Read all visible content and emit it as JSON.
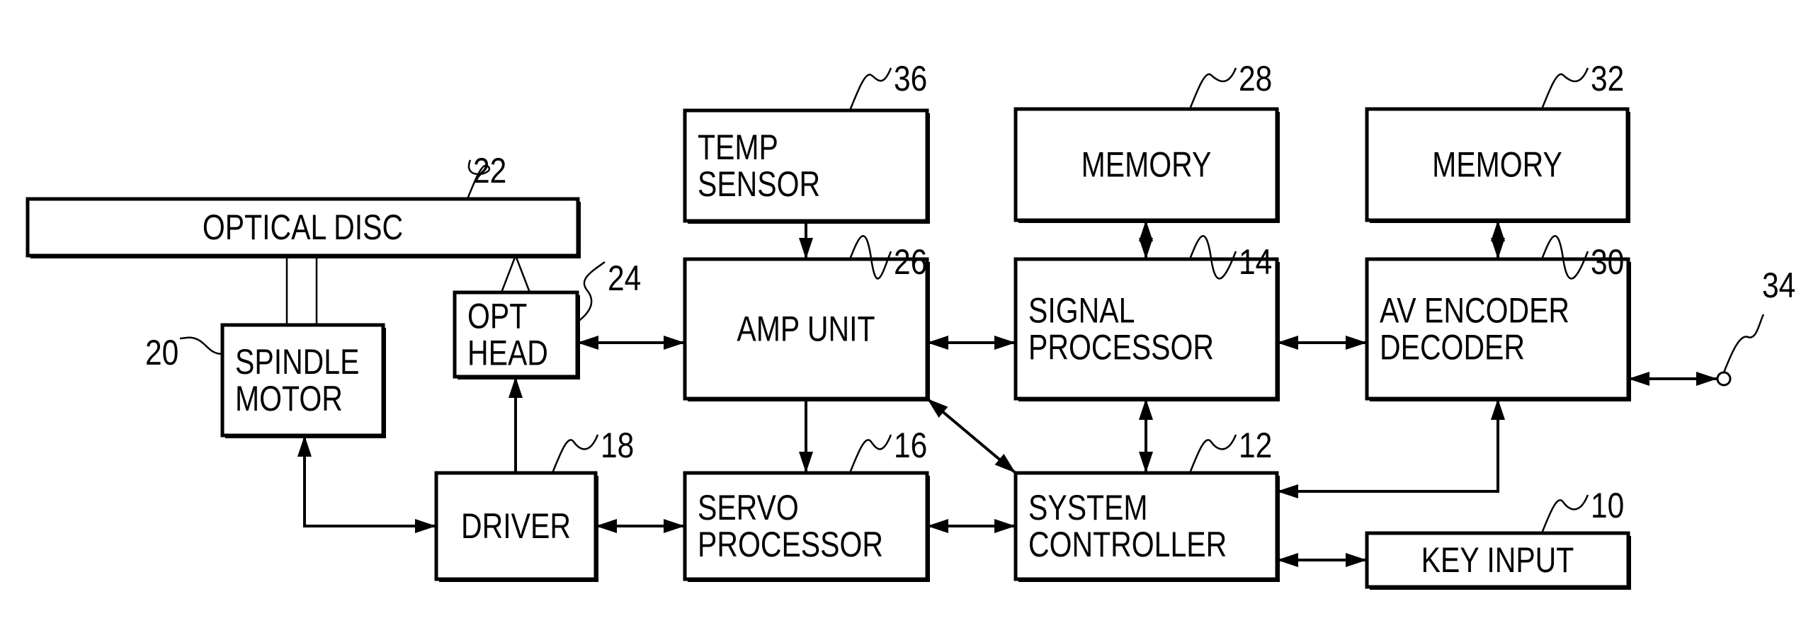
{
  "diagram": {
    "type": "block-diagram",
    "subject": "optical disc recording/reproducing apparatus",
    "blocks": [
      {
        "id": "optical_disc",
        "ref": "22",
        "lines": [
          "OPTICAL  DISC"
        ]
      },
      {
        "id": "spindle_motor",
        "ref": "20",
        "lines": [
          "SPINDLE",
          "MOTOR"
        ]
      },
      {
        "id": "opt_head",
        "ref": "24",
        "lines": [
          "OPT",
          "HEAD"
        ]
      },
      {
        "id": "temp_sensor",
        "ref": "36",
        "lines": [
          "TEMP",
          "SENSOR"
        ]
      },
      {
        "id": "amp_unit",
        "ref": "26",
        "lines": [
          "AMP  UNIT"
        ]
      },
      {
        "id": "memory_28",
        "ref": "28",
        "lines": [
          "MEMORY"
        ]
      },
      {
        "id": "signal_processor",
        "ref": "14",
        "lines": [
          "SIGNAL",
          "PROCESSOR"
        ]
      },
      {
        "id": "memory_32",
        "ref": "32",
        "lines": [
          "MEMORY"
        ]
      },
      {
        "id": "av_encoder_decoder",
        "ref": "30",
        "lines": [
          "AV  ENCODER",
          "DECODER"
        ]
      },
      {
        "id": "driver",
        "ref": "18",
        "lines": [
          "DRIVER"
        ]
      },
      {
        "id": "servo_processor",
        "ref": "16",
        "lines": [
          "SERVO",
          "PROCESSOR"
        ]
      },
      {
        "id": "system_controller",
        "ref": "12",
        "lines": [
          "SYSTEM",
          "CONTROLLER"
        ]
      },
      {
        "id": "key_input",
        "ref": "10",
        "lines": [
          "KEY  INPUT"
        ]
      }
    ],
    "terminal": {
      "id": "output_terminal",
      "ref": "34"
    },
    "connections": [
      {
        "from": "optical_disc",
        "to": "spindle_motor",
        "kind": "shaft"
      },
      {
        "from": "optical_disc",
        "to": "opt_head",
        "kind": "beam"
      },
      {
        "from": "driver",
        "to": "spindle_motor",
        "kind": "bidirectional"
      },
      {
        "from": "driver",
        "to": "opt_head",
        "kind": "directed"
      },
      {
        "from": "opt_head",
        "to": "amp_unit",
        "kind": "bidirectional"
      },
      {
        "from": "temp_sensor",
        "to": "amp_unit",
        "kind": "directed"
      },
      {
        "from": "amp_unit",
        "to": "signal_processor",
        "kind": "bidirectional"
      },
      {
        "from": "amp_unit",
        "to": "servo_processor",
        "kind": "directed"
      },
      {
        "from": "amp_unit",
        "to": "system_controller",
        "kind": "bidirectional"
      },
      {
        "from": "memory_28",
        "to": "signal_processor",
        "kind": "bidirectional"
      },
      {
        "from": "signal_processor",
        "to": "av_encoder_decoder",
        "kind": "bidirectional"
      },
      {
        "from": "signal_processor",
        "to": "system_controller",
        "kind": "bidirectional"
      },
      {
        "from": "memory_32",
        "to": "av_encoder_decoder",
        "kind": "bidirectional"
      },
      {
        "from": "av_encoder_decoder",
        "to": "output_terminal",
        "kind": "bidirectional"
      },
      {
        "from": "system_controller",
        "to": "av_encoder_decoder",
        "kind": "bidirectional"
      },
      {
        "from": "driver",
        "to": "servo_processor",
        "kind": "bidirectional"
      },
      {
        "from": "servo_processor",
        "to": "system_controller",
        "kind": "bidirectional"
      },
      {
        "from": "system_controller",
        "to": "key_input",
        "kind": "bidirectional"
      }
    ]
  }
}
